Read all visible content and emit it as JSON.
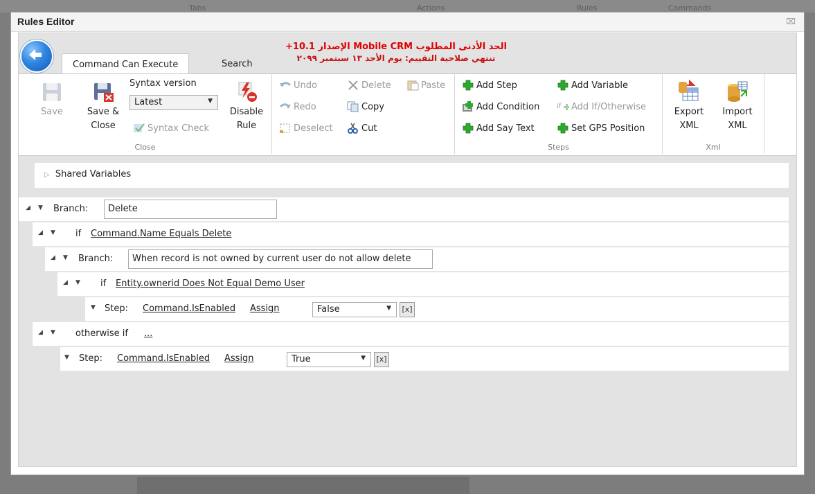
{
  "background": {
    "header_labels": [
      "Tabs",
      "Actions",
      "Rules",
      "Commands"
    ]
  },
  "dialog": {
    "title": "Rules Editor",
    "close_glyph": "⌧"
  },
  "tabs": [
    {
      "label": "Command Can Execute",
      "active": true
    },
    {
      "label": "Search",
      "active": false
    }
  ],
  "notice": {
    "line1": "الحد الأدنى المطلوب Mobile CRM الإصدار 10.1+",
    "line2": "تنتهي صلاحية التقييم: يوم الأحد ١٣ سبتمبر ٢٠٩٩"
  },
  "ribbon": {
    "close_group": {
      "label": "Close",
      "save": "Save",
      "save_close_1": "Save &",
      "save_close_2": "Close",
      "syntax_version_label": "Syntax version",
      "syntax_version_value": "Latest",
      "syntax_check": "Syntax Check",
      "disable_rule_1": "Disable",
      "disable_rule_2": "Rule"
    },
    "edit_group": {
      "undo": "Undo",
      "redo": "Redo",
      "deselect": "Deselect",
      "delete": "Delete",
      "copy": "Copy",
      "cut": "Cut",
      "paste": "Paste"
    },
    "steps_group": {
      "label": "Steps",
      "add_step": "Add Step",
      "add_condition": "Add Condition",
      "add_say_text": "Add Say Text",
      "add_variable": "Add Variable",
      "add_if_otherwise": "Add If/Otherwise",
      "set_gps_position": "Set GPS Position"
    },
    "xml_group": {
      "label": "Xml",
      "export_1": "Export",
      "export_2": "XML",
      "import_1": "Import",
      "import_2": "XML"
    }
  },
  "rules": {
    "shared_variables": "Shared Variables",
    "branch1_label": "Branch:",
    "branch1_value": "Delete",
    "if1_label": "if",
    "if1_condition": "Command.Name Equals Delete",
    "branch2_label": "Branch:",
    "branch2_value": "When record is not owned by current user do not allow delete",
    "if2_label": "if",
    "if2_condition": "Entity.ownerid Does Not Equal Demo User",
    "step1_label": "Step:",
    "step1_target": "Command.IsEnabled",
    "step1_op": "Assign",
    "step1_value": "False",
    "otherwise_label": "otherwise if",
    "otherwise_condition": "...",
    "step2_label": "Step:",
    "step2_target": "Command.IsEnabled",
    "step2_op": "Assign",
    "step2_value": "True",
    "clear_glyph": "[x]"
  },
  "colors": {
    "accent_blue": "#1a3fd6",
    "notice_red": "#e00000",
    "add_green": "#2fa82f"
  }
}
